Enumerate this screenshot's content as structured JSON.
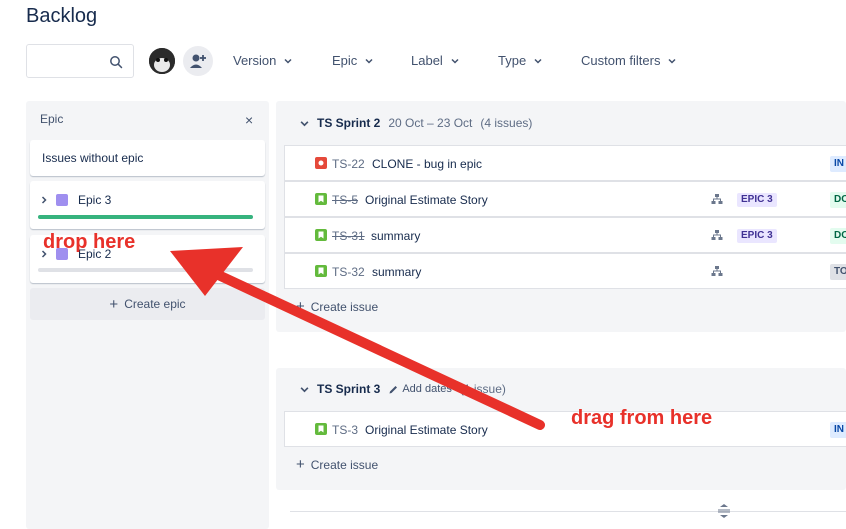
{
  "header": {
    "title": "Backlog"
  },
  "toolbar": {
    "search_placeholder": "",
    "filters": [
      "Version",
      "Epic",
      "Label",
      "Type",
      "Custom filters"
    ]
  },
  "epic_panel": {
    "heading": "Epic",
    "close_label": "×",
    "without_epic": "Issues without epic",
    "epics": [
      {
        "name": "Epic 3",
        "progress": 1.0,
        "progress_color": "#36b37e",
        "swatch": "#9f8fef"
      },
      {
        "name": "Epic 2",
        "progress": 0.0,
        "progress_color": "#dfe1e6",
        "swatch": "#9f8fef"
      }
    ],
    "create_epic_label": "Create epic"
  },
  "sprints": [
    {
      "name": "TS Sprint 2",
      "dates": "20 Oct – 23 Oct",
      "count": "(4 issues)",
      "issues": [
        {
          "type": "bug",
          "key": "TS-22",
          "done": false,
          "summary": "CLONE - bug in epic",
          "epic": "",
          "status": "IN",
          "has_child_icon": false
        },
        {
          "type": "story",
          "key": "TS-5",
          "done": true,
          "summary": "Original Estimate Story",
          "epic": "EPIC 3",
          "status": "DO",
          "has_child_icon": true
        },
        {
          "type": "story",
          "key": "TS-31",
          "done": true,
          "summary": "summary",
          "epic": "EPIC 3",
          "status": "DO",
          "has_child_icon": true
        },
        {
          "type": "story",
          "key": "TS-32",
          "done": false,
          "summary": "summary",
          "epic": "",
          "status": "TO",
          "has_child_icon": true
        }
      ],
      "create_issue_label": "Create issue"
    },
    {
      "name": "TS Sprint 3",
      "add_dates_label": "Add dates",
      "count": "(1 issue)",
      "issues": [
        {
          "type": "story",
          "key": "TS-3",
          "done": false,
          "summary": "Original Estimate Story",
          "epic": "",
          "status": "IN",
          "has_child_icon": false
        }
      ],
      "create_issue_label": "Create issue"
    }
  ],
  "annotations": {
    "drop": "drop here",
    "drag": "drag from here",
    "color": "#e8312a"
  },
  "colors": {
    "bug": "#e5493a",
    "story": "#63ba3c",
    "status_in_bg": "#deebff",
    "status_in_fg": "#0747a6",
    "status_done_bg": "#e3fcef",
    "status_done_fg": "#006644",
    "status_todo_bg": "#dfe1e6",
    "status_todo_fg": "#42526e"
  }
}
